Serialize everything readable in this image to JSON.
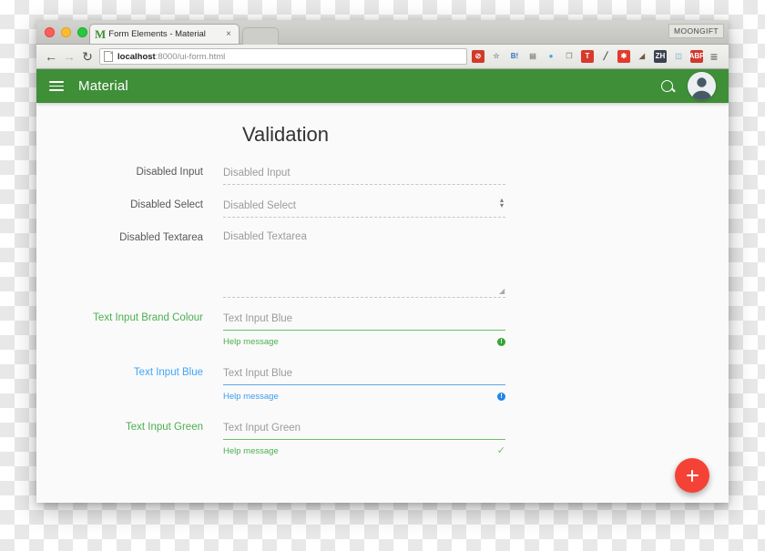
{
  "browser": {
    "watermark": "MOONGIFT",
    "tab": {
      "favicon_letter": "M",
      "title": "Form Elements - Material",
      "close": "×"
    },
    "nav": {
      "back": "←",
      "forward": "→",
      "reload": "↻",
      "menu": "≡"
    },
    "url": {
      "host": "localhost",
      "rest": ":8000/ui-form.html"
    },
    "extensions": [
      {
        "name": "block-icon",
        "label": "⊘",
        "color": "#d23a2a",
        "text": "#ffffff"
      },
      {
        "name": "bookmark-star-icon",
        "label": "☆",
        "color": "transparent",
        "text": "#8a8a8a"
      },
      {
        "name": "hatena-icon",
        "label": "B!",
        "color": "transparent",
        "text": "#2f72c4"
      },
      {
        "name": "pocket-icon",
        "label": "▤",
        "color": "transparent",
        "text": "#8a8a8a"
      },
      {
        "name": "evernote-icon",
        "label": "●",
        "color": "transparent",
        "text": "#3ba7d8"
      },
      {
        "name": "window-icon",
        "label": "❐",
        "color": "transparent",
        "text": "#9a9a9a"
      },
      {
        "name": "todoist-icon",
        "label": "T",
        "color": "#d8392b",
        "text": "#ffffff"
      },
      {
        "name": "eyedropper-icon",
        "label": "╱",
        "color": "transparent",
        "text": "#444444"
      },
      {
        "name": "puzzle-icon",
        "label": "✱",
        "color": "#e23b2e",
        "text": "#ffffff"
      },
      {
        "name": "paint-icon",
        "label": "◢",
        "color": "transparent",
        "text": "#6f5b3e"
      },
      {
        "name": "zh-translate-icon",
        "label": "ZH",
        "color": "#3b4250",
        "text": "#ffffff"
      },
      {
        "name": "tabs-icon",
        "label": "◫",
        "color": "transparent",
        "text": "#8fbcd4"
      },
      {
        "name": "adblock-icon",
        "label": "ABP",
        "color": "#d0392b",
        "text": "#ffffff"
      }
    ]
  },
  "appbar": {
    "title": "Material",
    "menu_icon": "hamburger-icon",
    "search_icon": "search-icon",
    "avatar": "user-avatar"
  },
  "page": {
    "title": "Validation",
    "fields": [
      {
        "label": "Disabled Input",
        "label_color": "gray",
        "placeholder": "Disabled Input",
        "underline": "dotted",
        "type": "input",
        "help": null,
        "badge": null
      },
      {
        "label": "Disabled Select",
        "label_color": "gray",
        "placeholder": "Disabled Select",
        "underline": "dotted",
        "type": "select",
        "help": null,
        "badge": null
      },
      {
        "label": "Disabled Textarea",
        "label_color": "gray",
        "placeholder": "Disabled Textarea",
        "underline": "dotted",
        "type": "textarea",
        "help": null,
        "badge": null
      },
      {
        "label": "Text Input Brand Colour",
        "label_color": "green",
        "placeholder": "Text Input Blue",
        "underline": "green",
        "type": "input",
        "help": "Help message",
        "badge": "info-green"
      },
      {
        "label": "Text Input Blue",
        "label_color": "blue",
        "placeholder": "Text Input Blue",
        "underline": "blue",
        "type": "input",
        "help": "Help message",
        "badge": "info-blue"
      },
      {
        "label": "Text Input Green",
        "label_color": "green",
        "placeholder": "Text Input Green",
        "underline": "green",
        "type": "input",
        "help": "Help message",
        "badge": "check-green"
      }
    ],
    "fab": {
      "icon": "plus-icon",
      "color": "#f44336"
    }
  },
  "colors": {
    "brand_green": "#3f8e38",
    "accent_green": "#4caf50",
    "accent_blue": "#42a5f5",
    "fab_red": "#f44336"
  }
}
